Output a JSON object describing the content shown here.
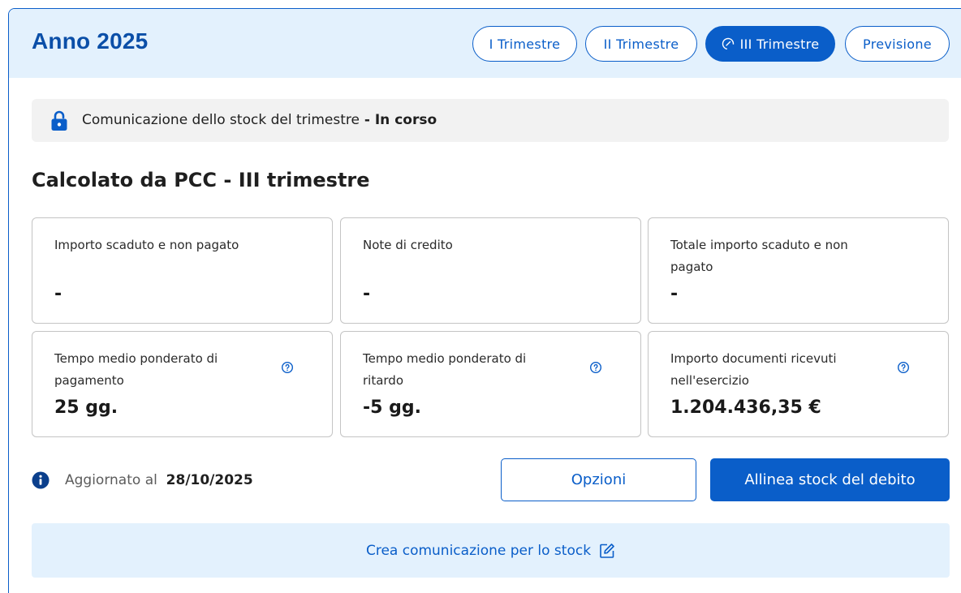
{
  "header": {
    "title": "Anno 2025",
    "tabs": [
      {
        "label": "I Trimestre",
        "active": false
      },
      {
        "label": "II Trimestre",
        "active": false
      },
      {
        "label": "III Trimestre",
        "active": true,
        "icon": "gauge-icon"
      },
      {
        "label": "Previsione",
        "active": false
      }
    ]
  },
  "status": {
    "icon": "lock-icon",
    "text": "Comunicazione dello stock del trimestre",
    "separator": " - ",
    "state": "In corso"
  },
  "section_title": "Calcolato da PCC - III trimestre",
  "cards": [
    {
      "label": "Importo scaduto e non pagato",
      "value": "-",
      "help": false
    },
    {
      "label": "Note di credito",
      "value": "-",
      "help": false
    },
    {
      "label": "Totale importo scaduto e non pagato",
      "value": "-",
      "help": false
    },
    {
      "label": "Tempo medio ponderato di pagamento",
      "value": "25 gg.",
      "help": true
    },
    {
      "label": "Tempo medio ponderato di ritardo",
      "value": "-5 gg.",
      "help": true
    },
    {
      "label": "Importo documenti ricevuti nell'esercizio",
      "value": "1.204.436,35 €",
      "help": true
    }
  ],
  "updated": {
    "icon": "info-icon",
    "label": "Aggiornato al",
    "date": "28/10/2025"
  },
  "buttons": {
    "options": "Opzioni",
    "align": "Allinea stock del debito"
  },
  "create": {
    "label": "Crea comunicazione per lo stock",
    "icon": "edit-icon"
  },
  "colors": {
    "primary": "#0a5ec9",
    "title_blue": "#0b4fa8",
    "header_bg": "#e3f1fd",
    "status_bg": "#f2f2f2"
  }
}
